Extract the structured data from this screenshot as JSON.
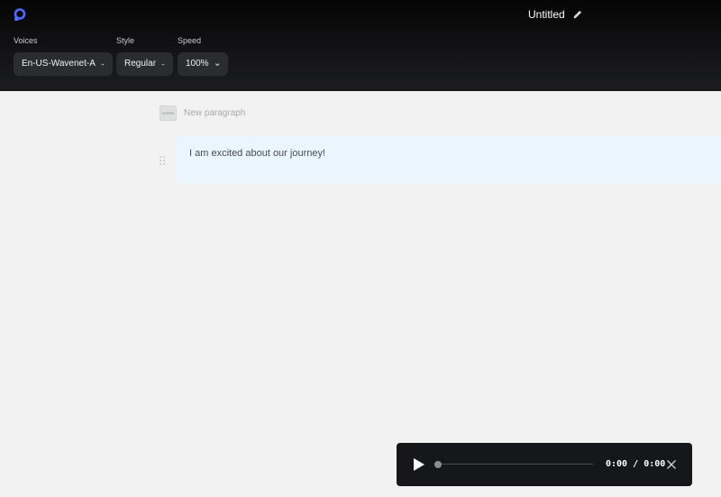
{
  "header": {
    "logo_icon": "logo-icon",
    "title": "Untitled",
    "edit_icon": "pencil-icon"
  },
  "controls": {
    "voices": {
      "label": "Voices",
      "value": "En-US-Wavenet-A"
    },
    "style": {
      "label": "Style",
      "value": "Regular"
    },
    "speed": {
      "label": "Speed",
      "value": "100%"
    }
  },
  "editor": {
    "new_paragraph_label": "New paragraph",
    "paragraphs": [
      {
        "text": "I am excited about our journey!"
      }
    ]
  },
  "player": {
    "current_time": "0:00",
    "separator": "/",
    "duration": "0:00",
    "progress": 0,
    "play_icon": "play-icon",
    "close_icon": "close-icon"
  },
  "colors": {
    "accent": "#4f6bff",
    "header_bg": "#141416",
    "page_bg": "#f2f2f2",
    "paragraph_bg": "#eaf5fd",
    "player_bg": "#16171a"
  }
}
